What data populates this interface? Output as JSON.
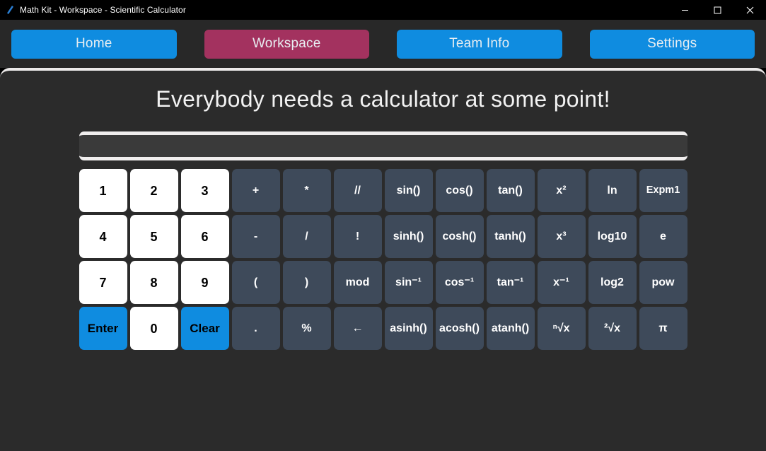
{
  "window": {
    "title": "Math Kit - Workspace - Scientific Calculator",
    "app_icon": "pencil-icon",
    "controls": {
      "minimize": "minimize-icon",
      "maximize": "maximize-icon",
      "close": "close-icon"
    }
  },
  "nav": {
    "items": [
      {
        "label": "Home",
        "active": false
      },
      {
        "label": "Workspace",
        "active": true
      },
      {
        "label": "Team Info",
        "active": false
      },
      {
        "label": "Settings",
        "active": false
      }
    ]
  },
  "main": {
    "heading": "Everybody needs a calculator at some point!",
    "display": {
      "value": "",
      "placeholder": ""
    }
  },
  "keypad": {
    "rows": [
      [
        {
          "label": "1",
          "kind": "num"
        },
        {
          "label": "2",
          "kind": "num"
        },
        {
          "label": "3",
          "kind": "num"
        },
        {
          "label": "+",
          "kind": "fn"
        },
        {
          "label": "*",
          "kind": "fn"
        },
        {
          "label": "//",
          "kind": "fn"
        },
        {
          "label": "sin()",
          "kind": "fn"
        },
        {
          "label": "cos()",
          "kind": "fn"
        },
        {
          "label": "tan()",
          "kind": "fn"
        },
        {
          "label": "x²",
          "kind": "fn"
        },
        {
          "label": "ln",
          "kind": "fn"
        },
        {
          "label": "Expm1",
          "kind": "fn",
          "small": true
        }
      ],
      [
        {
          "label": "4",
          "kind": "num"
        },
        {
          "label": "5",
          "kind": "num"
        },
        {
          "label": "6",
          "kind": "num"
        },
        {
          "label": "-",
          "kind": "fn"
        },
        {
          "label": "/",
          "kind": "fn"
        },
        {
          "label": "!",
          "kind": "fn"
        },
        {
          "label": "sinh()",
          "kind": "fn"
        },
        {
          "label": "cosh()",
          "kind": "fn"
        },
        {
          "label": "tanh()",
          "kind": "fn"
        },
        {
          "label": "x³",
          "kind": "fn"
        },
        {
          "label": "log10",
          "kind": "fn"
        },
        {
          "label": "e",
          "kind": "fn"
        }
      ],
      [
        {
          "label": "7",
          "kind": "num"
        },
        {
          "label": "8",
          "kind": "num"
        },
        {
          "label": "9",
          "kind": "num"
        },
        {
          "label": "(",
          "kind": "fn"
        },
        {
          "label": ")",
          "kind": "fn"
        },
        {
          "label": "mod",
          "kind": "fn"
        },
        {
          "label": "sin⁻¹",
          "kind": "fn"
        },
        {
          "label": "cos⁻¹",
          "kind": "fn"
        },
        {
          "label": "tan⁻¹",
          "kind": "fn"
        },
        {
          "label": "x⁻¹",
          "kind": "fn"
        },
        {
          "label": "log2",
          "kind": "fn"
        },
        {
          "label": "pow",
          "kind": "fn"
        }
      ],
      [
        {
          "label": "Enter",
          "kind": "accent"
        },
        {
          "label": "0",
          "kind": "num"
        },
        {
          "label": "Clear",
          "kind": "accent"
        },
        {
          "label": ".",
          "kind": "fn"
        },
        {
          "label": "%",
          "kind": "fn"
        },
        {
          "label": "←",
          "kind": "fn"
        },
        {
          "label": "asinh()",
          "kind": "fn"
        },
        {
          "label": "acosh()",
          "kind": "fn"
        },
        {
          "label": "atanh()",
          "kind": "fn"
        },
        {
          "label": "ⁿ√x",
          "kind": "fn"
        },
        {
          "label": "²√x",
          "kind": "fn"
        },
        {
          "label": "π",
          "kind": "fn"
        }
      ]
    ]
  }
}
